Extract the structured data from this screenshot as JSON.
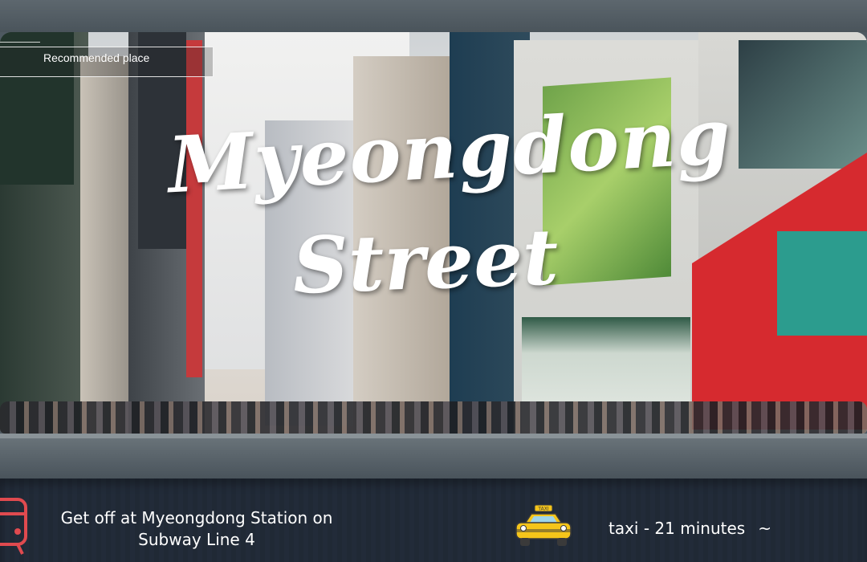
{
  "banner": {
    "label": "Recommended place",
    "title_line1": "Myeongdong",
    "title_line2": "Street"
  },
  "directions": {
    "subway_text": "Get off at Myeongdong Station on Subway Line 4",
    "taxi_text": "taxi - 21 minutes",
    "taxi_suffix": "~",
    "icons": [
      "bus-icon",
      "taxi-icon"
    ]
  },
  "colors": {
    "title_text": "#ffffff",
    "taxi_body": "#f5c51a",
    "bus_icon": "#e04a4f",
    "seat": "#2f4058"
  }
}
